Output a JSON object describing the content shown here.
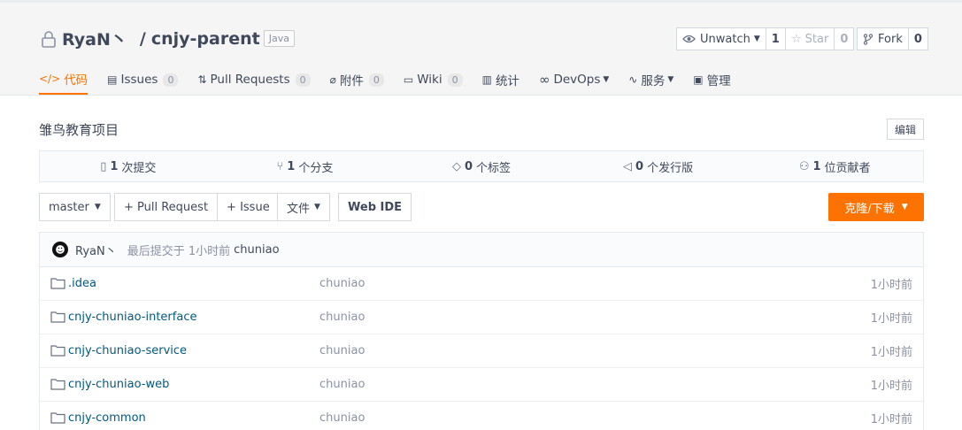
{
  "repo": {
    "owner": "RyaN丶",
    "separator": "/",
    "name": "cnjy-parent",
    "language": "Java"
  },
  "actions": {
    "watch_label": "Unwatch",
    "watch_count": "1",
    "star_label": "Star",
    "star_count": "0",
    "fork_label": "Fork",
    "fork_count": "0"
  },
  "tabs": [
    {
      "label": "代码",
      "icon": "code-icon",
      "count": ""
    },
    {
      "label": "Issues",
      "icon": "issues-icon",
      "count": "0"
    },
    {
      "label": "Pull Requests",
      "icon": "pull-request-icon",
      "count": "0"
    },
    {
      "label": "附件",
      "icon": "paperclip-icon",
      "count": "0"
    },
    {
      "label": "Wiki",
      "icon": "book-icon",
      "count": "0"
    },
    {
      "label": "统计",
      "icon": "bar-chart-icon",
      "count": ""
    },
    {
      "label": "DevOps",
      "icon": "infinity-icon",
      "count": ""
    },
    {
      "label": "服务",
      "icon": "pulse-icon",
      "count": ""
    },
    {
      "label": "管理",
      "icon": "settings-doc-icon",
      "count": ""
    }
  ],
  "description": "雏鸟教育项目",
  "edit_label": "编辑",
  "stats": [
    {
      "icon": "commit-doc-icon",
      "value": "1",
      "label": "次提交"
    },
    {
      "icon": "branch-icon",
      "value": "1",
      "label": "个分支"
    },
    {
      "icon": "tag-icon",
      "value": "0",
      "label": "个标签"
    },
    {
      "icon": "release-icon",
      "value": "0",
      "label": "个发行版"
    },
    {
      "icon": "contributors-icon",
      "value": "1",
      "label": "位贡献者"
    }
  ],
  "toolbar": {
    "branch": "master",
    "pull_request": "+ Pull Request",
    "issue": "+ Issue",
    "file": "文件",
    "web_ide": "Web IDE",
    "clone": "克隆/下载"
  },
  "last_commit": {
    "author": "RyaN丶",
    "meta": "最后提交于 1小时前",
    "message": "chuniao"
  },
  "files": [
    {
      "name": ".idea",
      "commit": "chuniao",
      "time": "1小时前"
    },
    {
      "name": "cnjy-chuniao-interface",
      "commit": "chuniao",
      "time": "1小时前"
    },
    {
      "name": "cnjy-chuniao-service",
      "commit": "chuniao",
      "time": "1小时前"
    },
    {
      "name": "cnjy-chuniao-web",
      "commit": "chuniao",
      "time": "1小时前"
    },
    {
      "name": "cnjy-common",
      "commit": "chuniao",
      "time": "1小时前"
    }
  ],
  "colors": {
    "accent": "#fe7300",
    "link": "#005980",
    "muted": "#8c92a4"
  }
}
